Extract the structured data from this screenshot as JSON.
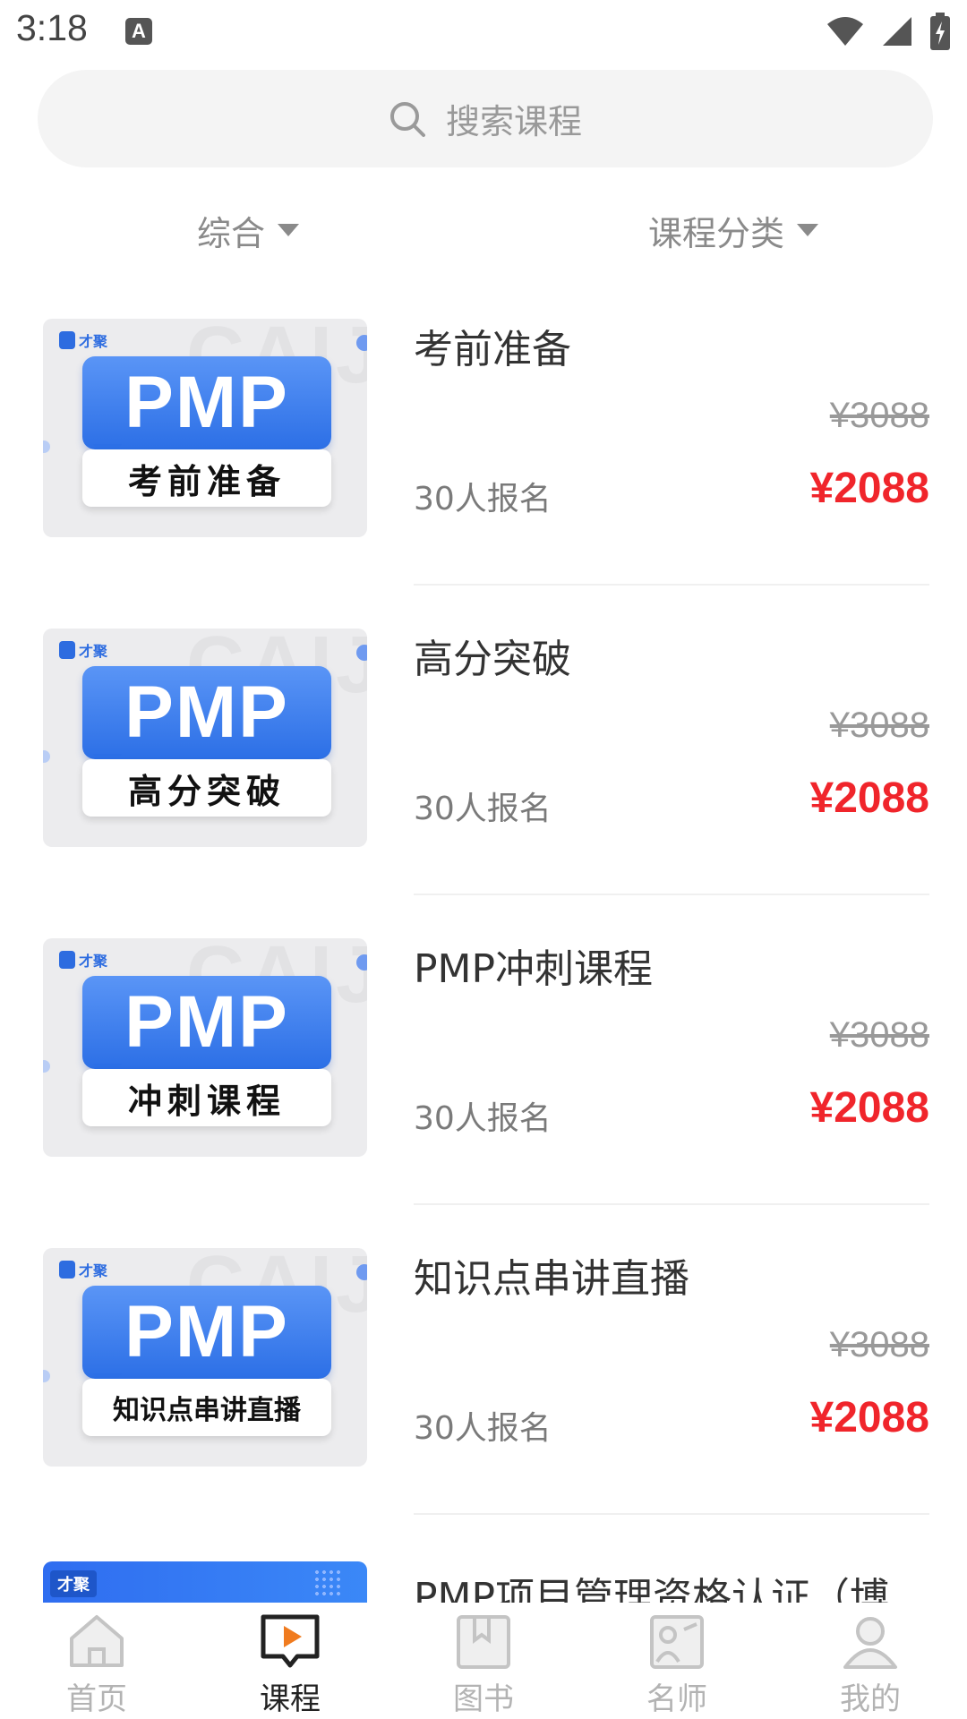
{
  "status_bar": {
    "time": "3:18",
    "notification_icon": "A"
  },
  "search": {
    "placeholder": "搜索课程"
  },
  "filters": {
    "sort_label": "综合",
    "category_label": "课程分类"
  },
  "courses": [
    {
      "title": "考前准备",
      "thumb_main": "PMP",
      "thumb_sub": "考前准备",
      "original_price": "¥3088",
      "price": "¥2088",
      "enrolled": "30人报名"
    },
    {
      "title": "高分突破",
      "thumb_main": "PMP",
      "thumb_sub": "高分突破",
      "original_price": "¥3088",
      "price": "¥2088",
      "enrolled": "30人报名"
    },
    {
      "title": "PMP冲刺课程",
      "thumb_main": "PMP",
      "thumb_sub": "冲刺课程",
      "original_price": "¥3088",
      "price": "¥2088",
      "enrolled": "30人报名"
    },
    {
      "title": "知识点串讲直播",
      "thumb_main": "PMP",
      "thumb_sub": "知识点串讲直播",
      "original_price": "¥3088",
      "price": "¥2088",
      "enrolled": "30人报名"
    }
  ],
  "partial_course": {
    "title": "PMP项目管理资格认证（博",
    "logo": "才聚"
  },
  "thumb_logo": "才聚",
  "tabs": [
    {
      "label": "首页",
      "icon": "home-icon",
      "active": false
    },
    {
      "label": "课程",
      "icon": "course-play-icon",
      "active": true
    },
    {
      "label": "图书",
      "icon": "book-icon",
      "active": false
    },
    {
      "label": "名师",
      "icon": "teacher-icon",
      "active": false
    },
    {
      "label": "我的",
      "icon": "profile-icon",
      "active": false
    }
  ],
  "colors": {
    "price_red": "#f0252b",
    "active_accent": "#f07b1f",
    "inactive_tab": "#b3b3b3"
  }
}
